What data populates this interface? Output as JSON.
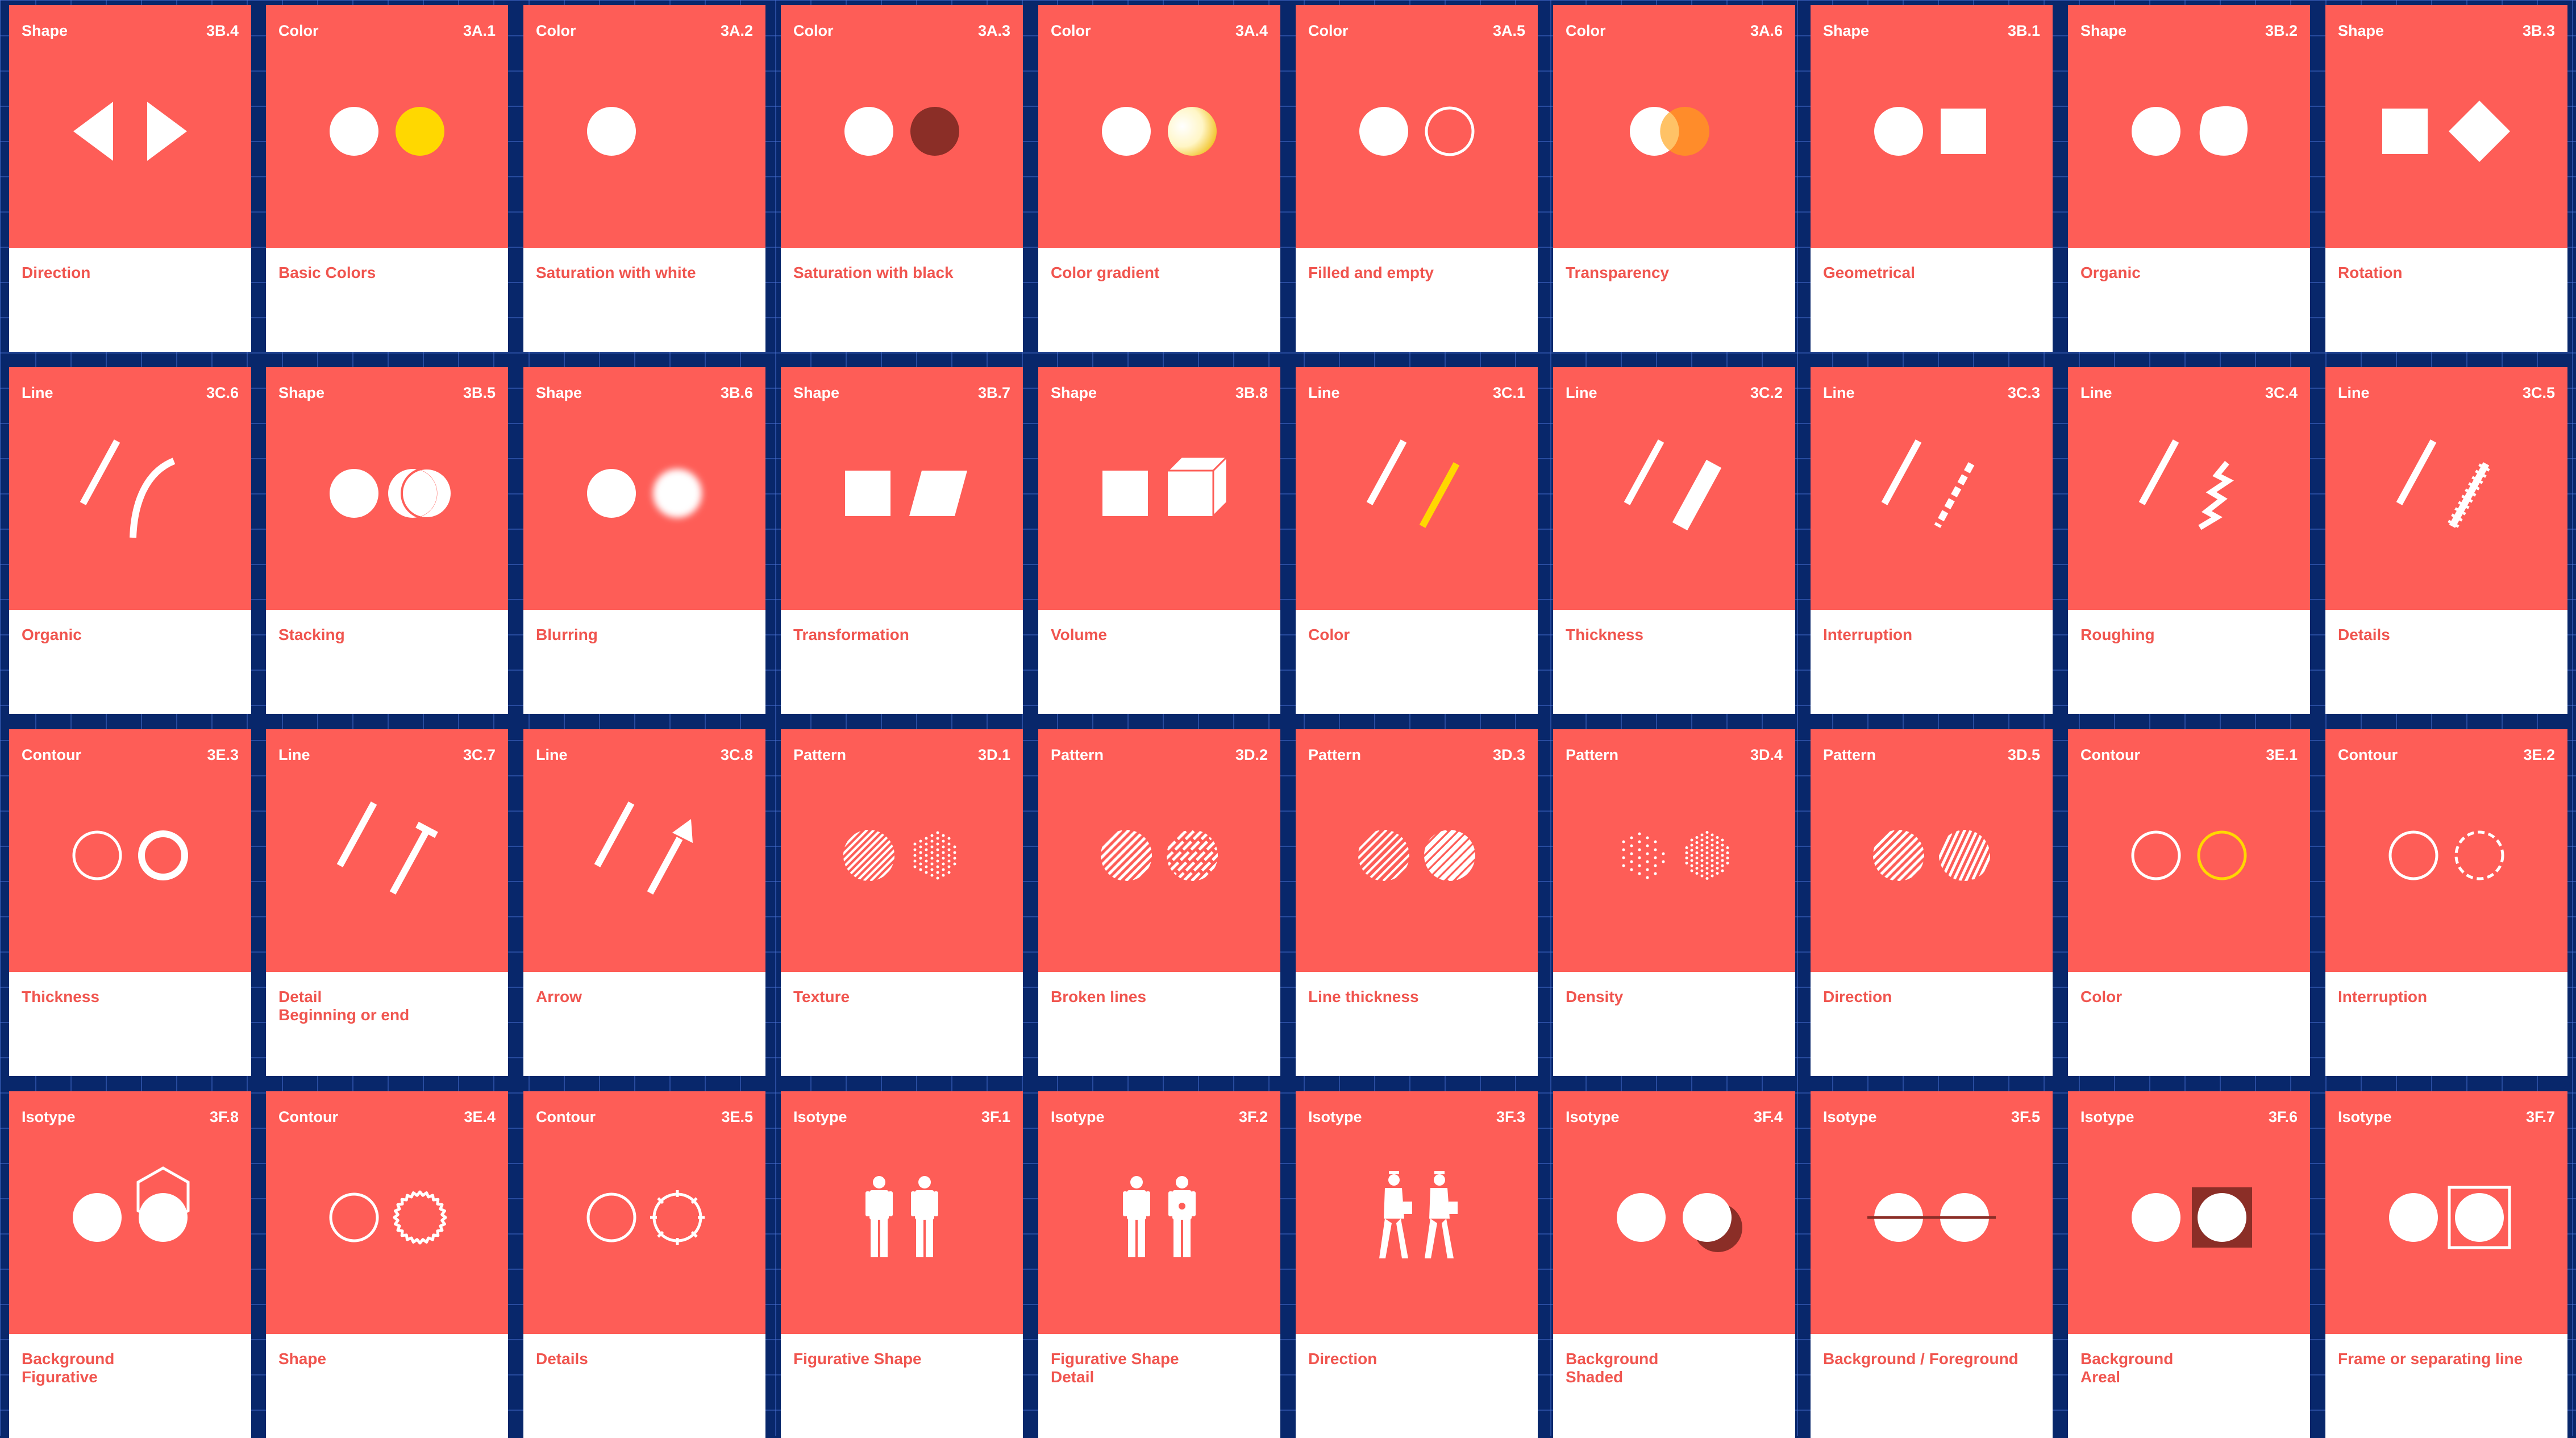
{
  "cards": [
    {
      "cat": "Shape",
      "code": "3B.4",
      "label": "Direction",
      "icon": "direction-arrows-icon"
    },
    {
      "cat": "Color",
      "code": "3A.1",
      "label": "Basic Colors",
      "icon": "basic-colors-icon"
    },
    {
      "cat": "Color",
      "code": "3A.2",
      "label": "Saturation with white",
      "icon": "single-circle-icon"
    },
    {
      "cat": "Color",
      "code": "3A.3",
      "label": "Saturation with black",
      "icon": "dark-circle-icon"
    },
    {
      "cat": "Color",
      "code": "3A.4",
      "label": "Color gradient",
      "icon": "gradient-circle-icon"
    },
    {
      "cat": "Color",
      "code": "3A.5",
      "label": "Filled and empty",
      "icon": "filled-empty-circle-icon"
    },
    {
      "cat": "Color",
      "code": "3A.6",
      "label": "Transparency",
      "icon": "transparent-circles-icon"
    },
    {
      "cat": "Shape",
      "code": "3B.1",
      "label": "Geometrical",
      "icon": "circle-square-icon"
    },
    {
      "cat": "Shape",
      "code": "3B.2",
      "label": "Organic",
      "icon": "organic-shape-icon"
    },
    {
      "cat": "Shape",
      "code": "3B.3",
      "label": "Rotation",
      "icon": "rotated-square-icon"
    },
    {
      "cat": "Line",
      "code": "3C.6",
      "label": "Organic",
      "icon": "curved-line-icon"
    },
    {
      "cat": "Shape",
      "code": "3B.5",
      "label": "Stacking",
      "icon": "stacked-circles-icon"
    },
    {
      "cat": "Shape",
      "code": "3B.6",
      "label": "Blurring",
      "icon": "blurred-circle-icon"
    },
    {
      "cat": "Shape",
      "code": "3B.7",
      "label": "Transformation",
      "icon": "parallelogram-icon"
    },
    {
      "cat": "Shape",
      "code": "3B.8",
      "label": "Volume",
      "icon": "cube-icon"
    },
    {
      "cat": "Line",
      "code": "3C.1",
      "label": "Color",
      "icon": "colored-line-icon"
    },
    {
      "cat": "Line",
      "code": "3C.2",
      "label": "Thickness",
      "icon": "thick-line-icon"
    },
    {
      "cat": "Line",
      "code": "3C.3",
      "label": "Interruption",
      "icon": "dashed-line-icon"
    },
    {
      "cat": "Line",
      "code": "3C.4",
      "label": "Roughing",
      "icon": "zigzag-line-icon"
    },
    {
      "cat": "Line",
      "code": "3C.5",
      "label": "Details",
      "icon": "ticked-line-icon"
    },
    {
      "cat": "Contour",
      "code": "3E.3",
      "label": "Thickness",
      "icon": "contour-thickness-icon"
    },
    {
      "cat": "Line",
      "code": "3C.7",
      "label": "Detail\nBeginning or end",
      "icon": "line-end-detail-icon"
    },
    {
      "cat": "Line",
      "code": "3C.8",
      "label": "Arrow",
      "icon": "arrow-line-icon"
    },
    {
      "cat": "Pattern",
      "code": "3D.1",
      "label": "Texture",
      "icon": "hatch-dots-texture-icon"
    },
    {
      "cat": "Pattern",
      "code": "3D.2",
      "label": "Broken lines",
      "icon": "broken-hatch-icon"
    },
    {
      "cat": "Pattern",
      "code": "3D.3",
      "label": "Line thickness",
      "icon": "hatch-thickness-icon"
    },
    {
      "cat": "Pattern",
      "code": "3D.4",
      "label": "Density",
      "icon": "dot-density-icon"
    },
    {
      "cat": "Pattern",
      "code": "3D.5",
      "label": "Direction",
      "icon": "hatch-direction-icon"
    },
    {
      "cat": "Contour",
      "code": "3E.1",
      "label": "Color",
      "icon": "colored-contour-icon"
    },
    {
      "cat": "Contour",
      "code": "3E.2",
      "label": "Interruption",
      "icon": "dashed-contour-icon"
    },
    {
      "cat": "Isotype",
      "code": "3F.8",
      "label": "Background\nFigurative",
      "icon": "hexagon-background-icon"
    },
    {
      "cat": "Contour",
      "code": "3E.4",
      "label": "Shape",
      "icon": "wavy-contour-icon"
    },
    {
      "cat": "Contour",
      "code": "3E.5",
      "label": "Details",
      "icon": "detailed-contour-icon"
    },
    {
      "cat": "Isotype",
      "code": "3F.1",
      "label": "Figurative Shape",
      "icon": "person-figures-icon"
    },
    {
      "cat": "Isotype",
      "code": "3F.2",
      "label": "Figurative Shape\nDetail",
      "icon": "person-detail-icon"
    },
    {
      "cat": "Isotype",
      "code": "3F.3",
      "label": "Direction",
      "icon": "walking-person-icon"
    },
    {
      "cat": "Isotype",
      "code": "3F.4",
      "label": "Background\nShaded",
      "icon": "shaded-circle-icon"
    },
    {
      "cat": "Isotype",
      "code": "3F.5",
      "label": "Background / Foreground",
      "icon": "line-through-circles-icon"
    },
    {
      "cat": "Isotype",
      "code": "3F.6",
      "label": "Background\nAreal",
      "icon": "areal-background-icon"
    },
    {
      "cat": "Isotype",
      "code": "3F.7",
      "label": "Frame or separating line",
      "icon": "framed-circle-icon"
    }
  ]
}
